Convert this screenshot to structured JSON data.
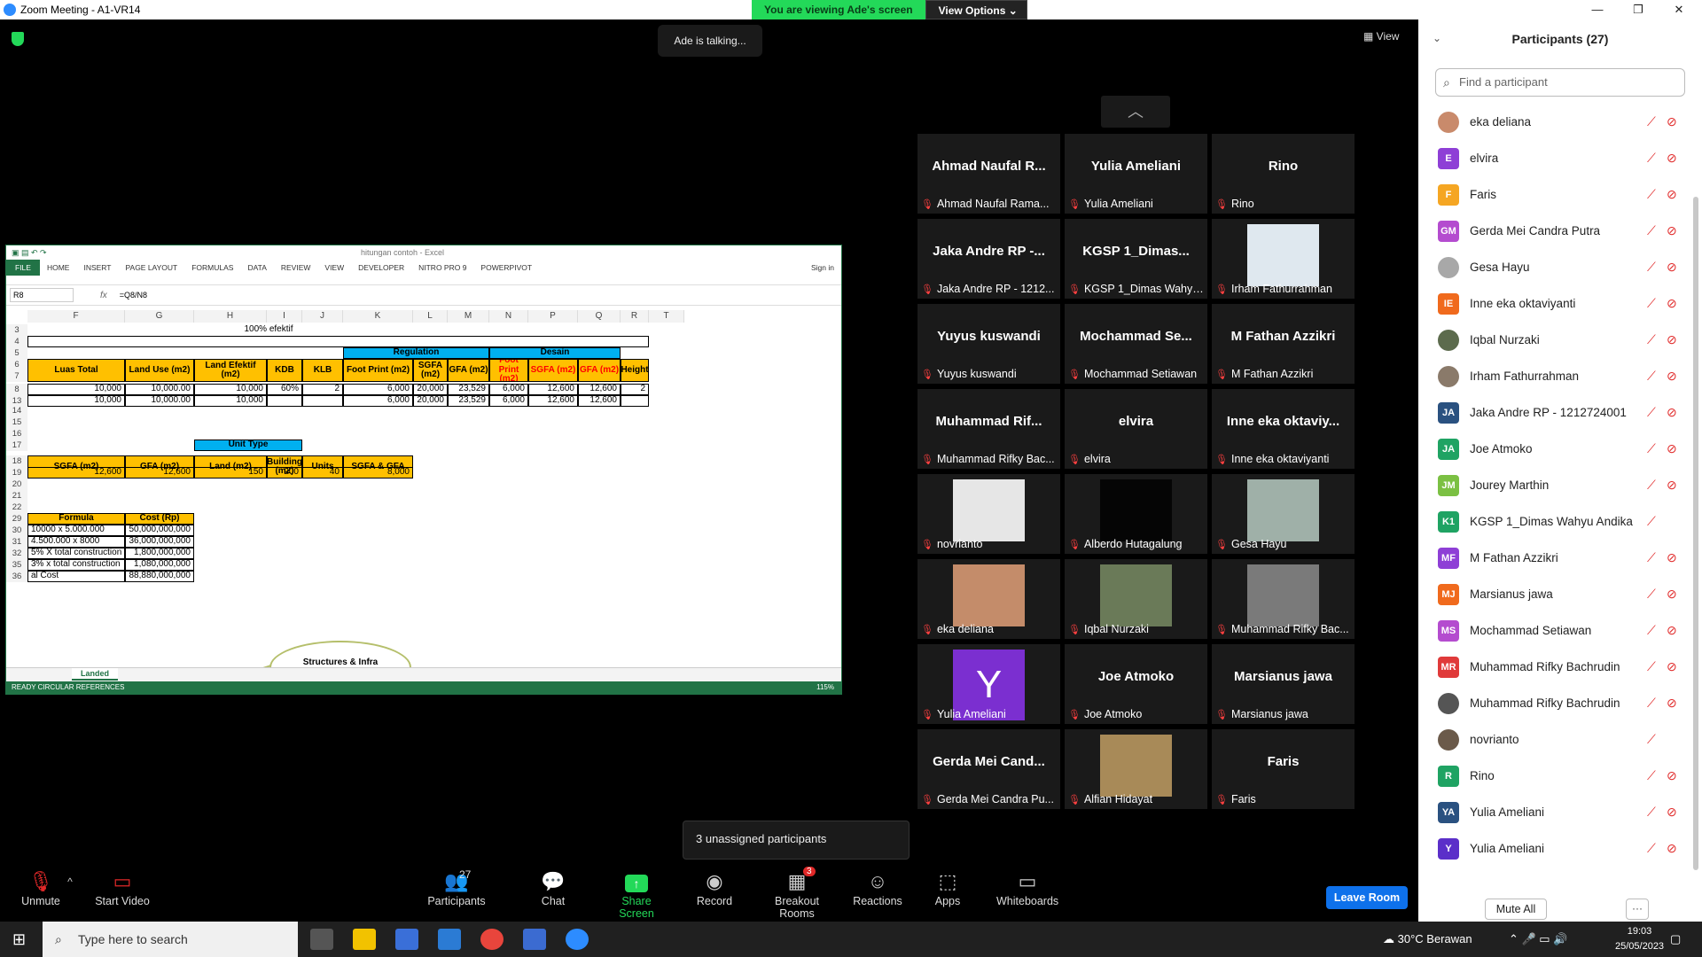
{
  "window": {
    "title": "Zoom Meeting - A1-VR14",
    "min": "—",
    "max": "❐",
    "close": "✕"
  },
  "banner": {
    "viewing": "You are viewing Ade's screen",
    "options": "View Options",
    "options_caret": "⌄"
  },
  "talking": "Ade is talking...",
  "view_button": "View",
  "excel": {
    "doc_title": "hitungan contoh - Excel",
    "tabs": [
      "FILE",
      "HOME",
      "INSERT",
      "PAGE LAYOUT",
      "FORMULAS",
      "DATA",
      "REVIEW",
      "VIEW",
      "DEVELOPER",
      "NITRO PRO 9",
      "POWERPIVOT"
    ],
    "signin": "Sign in",
    "namebox": "R8",
    "fx": "fx",
    "formula": "=Q8/N8",
    "columns": [
      "F",
      "G",
      "H",
      "I",
      "J",
      "K",
      "L",
      "M",
      "N",
      "P",
      "Q",
      "R",
      "T"
    ],
    "rows": [
      "3",
      "4",
      "5",
      "6",
      "7",
      "8",
      "13",
      "14",
      "15",
      "16",
      "17",
      "18",
      "19",
      "20",
      "21",
      "22",
      "29",
      "30",
      "31",
      "32",
      "35",
      "36"
    ],
    "efektif": "100% efektif",
    "regulation": "Regulation",
    "desain": "Desain",
    "headers": [
      "Luas Total",
      "Land Use (m2)",
      "Land Efektif (m2)",
      "KDB",
      "KLB",
      "Foot Print (m2)",
      "SGFA (m2)",
      "GFA (m2)",
      "Foot Print (m2)",
      "SGFA  (m2)",
      "GFA  (m2)",
      "Height"
    ],
    "row8": [
      "10,000",
      "10,000.00",
      "10,000",
      "60%",
      "2",
      "6,000",
      "20,000",
      "23,529",
      "6,000",
      "12,600",
      "12,600",
      "2"
    ],
    "row13": [
      "10,000",
      "10,000.00",
      "10,000",
      "",
      "",
      "6,000",
      "20,000",
      "23,529",
      "6,000",
      "12,600",
      "12,600",
      ""
    ],
    "unit_type": "Unit Type",
    "headers2": [
      "SGFA (m2)",
      "GFA (m2)",
      "Land (m2)",
      "Building (m2)",
      "Units",
      "SGFA & GFA"
    ],
    "row19": [
      "12,600",
      "12,600",
      "150",
      "200",
      "40",
      "8,000"
    ],
    "cost_headers": [
      "Formula",
      "Cost (Rp)"
    ],
    "costs": [
      [
        "10000 x 5.000.000",
        "50,000,000,000"
      ],
      [
        "4.500.000 x 8000",
        "36,000,000,000"
      ],
      [
        "5% X total construction",
        "1,800,000,000"
      ],
      [
        "3% x total construction",
        "1,080,000,000"
      ],
      [
        "al Cost",
        "88,880,000,000"
      ]
    ],
    "callout": "Structures & Infra structures",
    "sheet_tab": "Landed",
    "status": "READY    CIRCULAR REFERENCES",
    "zoom": "115%"
  },
  "tiles": [
    {
      "big": "Ahmad Naufal R...",
      "cap": "Ahmad Naufal Rama..."
    },
    {
      "big": "Yulia Ameliani",
      "cap": "Yulia Ameliani"
    },
    {
      "big": "Rino",
      "cap": "Rino"
    },
    {
      "big": "Jaka Andre RP -...",
      "cap": "Jaka Andre RP - 1212..."
    },
    {
      "big": "KGSP 1_Dimas...",
      "cap": "KGSP 1_Dimas Wahyu..."
    },
    {
      "big": "",
      "cap": "Irham Fathurrahman"
    },
    {
      "big": "Yuyus kuswandi",
      "cap": "Yuyus kuswandi"
    },
    {
      "big": "Mochammad Se...",
      "cap": "Mochammad Setiawan"
    },
    {
      "big": "M Fathan Azzikri",
      "cap": "M Fathan Azzikri"
    },
    {
      "big": "Muhammad Rif...",
      "cap": "Muhammad Rifky Bac..."
    },
    {
      "big": "elvira",
      "cap": "elvira"
    },
    {
      "big": "Inne eka oktaviy...",
      "cap": "Inne eka oktaviyanti"
    },
    {
      "big": "",
      "cap": "novrianto"
    },
    {
      "big": "",
      "cap": "Alberdo Hutagalung"
    },
    {
      "big": "",
      "cap": "Gesa Hayu"
    },
    {
      "big": "",
      "cap": "eka deliana"
    },
    {
      "big": "",
      "cap": "Iqbal Nurzaki"
    },
    {
      "big": "",
      "cap": "Muhammad Rifky Bac..."
    },
    {
      "big": "",
      "cap": "Yulia Ameliani",
      "letter": "Y"
    },
    {
      "big": "Joe Atmoko",
      "cap": "Joe Atmoko"
    },
    {
      "big": "Marsianus jawa",
      "cap": "Marsianus jawa"
    },
    {
      "big": "Gerda Mei Cand...",
      "cap": "Gerda Mei Candra Pu..."
    },
    {
      "big": "",
      "cap": "Alfian Hidayat"
    },
    {
      "big": "Faris",
      "cap": "Faris"
    }
  ],
  "unassigned": "3 unassigned participants",
  "toolbar": {
    "unmute": "Unmute",
    "start_video": "Start Video",
    "participants": "Participants",
    "participants_count": "27",
    "chat": "Chat",
    "share": "Share Screen",
    "record": "Record",
    "breakout": "Breakout Rooms",
    "breakout_badge": "3",
    "reactions": "Reactions",
    "apps": "Apps",
    "whiteboards": "Whiteboards",
    "leave": "Leave Room"
  },
  "panel": {
    "title": "Participants (27)",
    "search_placeholder": "Find a participant",
    "mute_all": "Mute All",
    "more": "···",
    "people": [
      {
        "name": "eka deliana",
        "initials": "",
        "color": "#c98a6b",
        "cam": true
      },
      {
        "name": "elvira",
        "initials": "E",
        "color": "#8e3fd6",
        "cam": true
      },
      {
        "name": "Faris",
        "initials": "F",
        "color": "#f5a623",
        "cam": true
      },
      {
        "name": "Gerda Mei Candra Putra",
        "initials": "GM",
        "color": "#b44ccf",
        "cam": true
      },
      {
        "name": "Gesa Hayu",
        "initials": "",
        "color": "#a8a8a8",
        "cam": true
      },
      {
        "name": "Inne eka oktaviyanti",
        "initials": "IE",
        "color": "#f06a1d",
        "cam": true
      },
      {
        "name": "Iqbal Nurzaki",
        "initials": "",
        "color": "#5c6b4d",
        "cam": true
      },
      {
        "name": "Irham Fathurrahman",
        "initials": "",
        "color": "#8a7a6a",
        "cam": true
      },
      {
        "name": "Jaka Andre RP - 1212724001",
        "initials": "JA",
        "color": "#2a5180",
        "cam": true
      },
      {
        "name": "Joe Atmoko",
        "initials": "JA",
        "color": "#1fa363",
        "cam": true
      },
      {
        "name": "Jourey Marthin",
        "initials": "JM",
        "color": "#7bc043",
        "cam": true
      },
      {
        "name": "KGSP 1_Dimas Wahyu Andika",
        "initials": "K1",
        "color": "#1fa363",
        "cam": false
      },
      {
        "name": "M Fathan Azzikri",
        "initials": "MF",
        "color": "#8e3fd6",
        "cam": true
      },
      {
        "name": "Marsianus jawa",
        "initials": "MJ",
        "color": "#f06a1d",
        "cam": true
      },
      {
        "name": "Mochammad Setiawan",
        "initials": "MS",
        "color": "#b44ccf",
        "cam": true
      },
      {
        "name": "Muhammad Rifky Bachrudin",
        "initials": "MR",
        "color": "#e03a3a",
        "cam": true
      },
      {
        "name": "Muhammad Rifky Bachrudin",
        "initials": "",
        "color": "#555555",
        "cam": true
      },
      {
        "name": "novrianto",
        "initials": "",
        "color": "#6b5a4a",
        "cam": false
      },
      {
        "name": "Rino",
        "initials": "R",
        "color": "#1fa363",
        "cam": true
      },
      {
        "name": "Yulia Ameliani",
        "initials": "YA",
        "color": "#2a5180",
        "cam": true
      },
      {
        "name": "Yulia Ameliani",
        "initials": "Y",
        "color": "#5b2fc9",
        "cam": true
      }
    ]
  },
  "taskbar": {
    "search": "Type here to search",
    "weather": "30°C  Berawan",
    "time": "19:03",
    "date": "25/05/2023"
  }
}
